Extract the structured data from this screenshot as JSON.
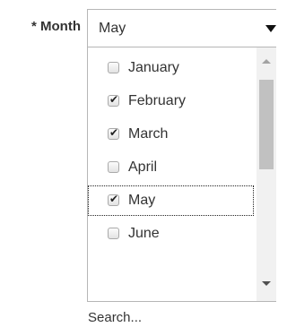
{
  "field": {
    "label": "* Month",
    "selected_value": "May"
  },
  "dropdown": {
    "options": [
      {
        "label": "January",
        "checked": false
      },
      {
        "label": "February",
        "checked": true
      },
      {
        "label": "March",
        "checked": true
      },
      {
        "label": "April",
        "checked": false
      },
      {
        "label": "May",
        "checked": true,
        "focused": true
      },
      {
        "label": "June",
        "checked": false
      }
    ],
    "check_glyph": "✔"
  },
  "search": {
    "placeholder": "Search..."
  },
  "colors": {
    "border": "#b6b6b6",
    "text": "#333333",
    "scrollbar_track": "#f1f1f1",
    "scrollbar_thumb": "#c1c1c1"
  }
}
